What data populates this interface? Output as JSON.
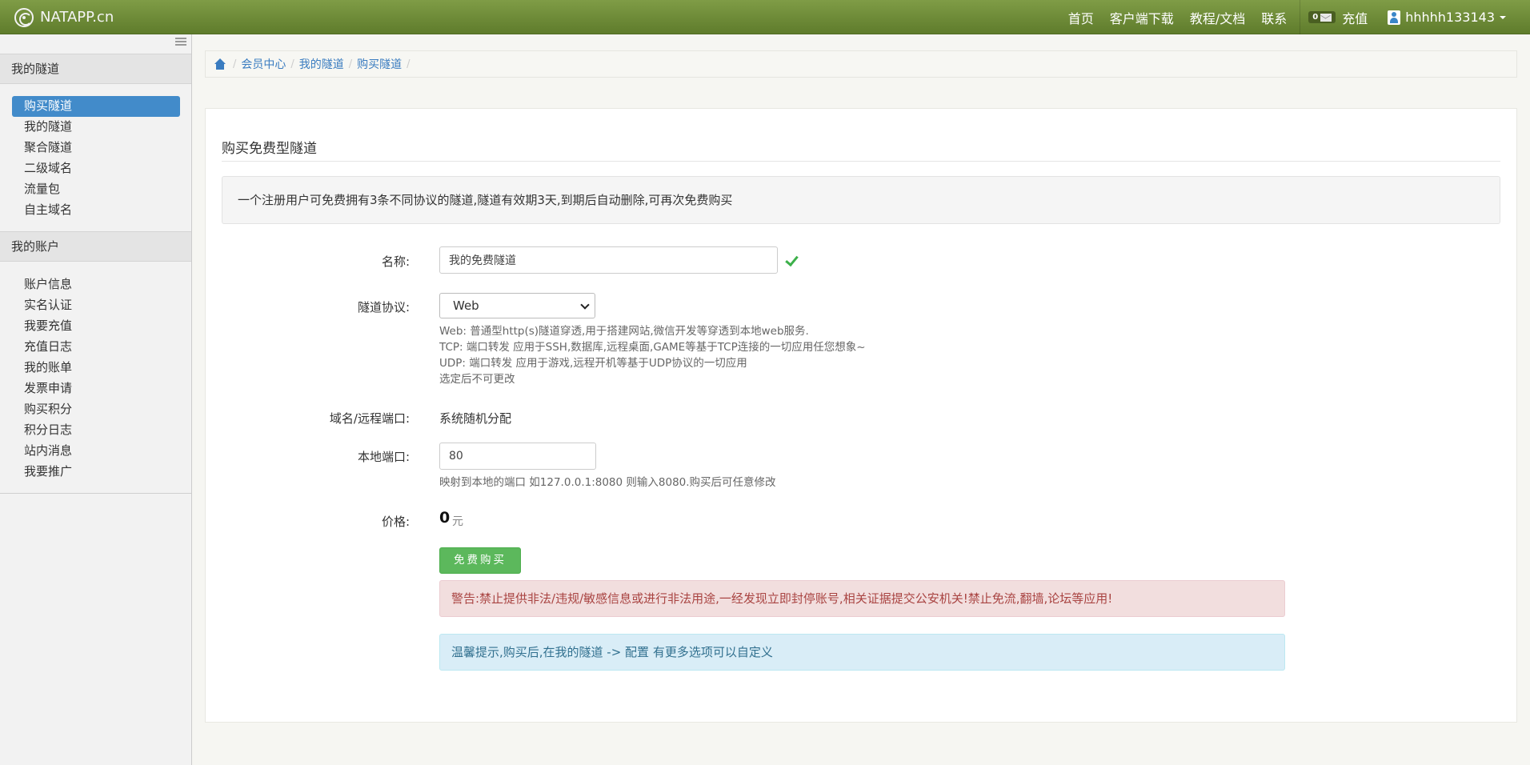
{
  "navbar": {
    "brand": "NATAPP.cn",
    "links": [
      "首页",
      "客户端下载",
      "教程/文档",
      "联系"
    ],
    "mail_count": "0",
    "recharge": "充值",
    "username": "hhhhh133143"
  },
  "sidebar": {
    "section1": "我的隧道",
    "tunnel_items": [
      "购买隧道",
      "我的隧道",
      "聚合隧道",
      "二级域名",
      "流量包",
      "自主域名"
    ],
    "section2": "我的账户",
    "account_items": [
      "账户信息",
      "实名认证",
      "我要充值",
      "充值日志",
      "我的账单",
      "发票申请",
      "购买积分",
      "积分日志",
      "站内消息",
      "我要推广"
    ]
  },
  "breadcrumb": [
    "会员中心",
    "我的隧道",
    "购买隧道"
  ],
  "main": {
    "title": "购买免费型隧道",
    "info": "一个注册用户可免费拥有3条不同协议的隧道,隧道有效期3天,到期后自动删除,可再次免费购买",
    "name_label": "名称:",
    "name_value": "我的免费隧道",
    "protocol_label": "隧道协议:",
    "protocol_value": "Web",
    "protocol_help": [
      "Web: 普通型http(s)隧道穿透,用于搭建网站,微信开发等穿透到本地web服务.",
      "TCP: 端口转发 应用于SSH,数据库,远程桌面,GAME等基于TCP连接的一切应用任您想象~",
      "UDP: 端口转发 应用于游戏,远程开机等基于UDP协议的一切应用",
      "选定后不可更改"
    ],
    "domain_label": "域名/远程端口:",
    "domain_value": "系统随机分配",
    "port_label": "本地端口:",
    "port_value": "80",
    "port_help": "映射到本地的端口 如127.0.0.1:8080 则输入8080.购买后可任意修改",
    "price_label": "价格:",
    "price_value": "0",
    "price_unit": "元",
    "buy_button": "免费购买",
    "warning": "警告:禁止提供非法/违规/敏感信息或进行非法用途,一经发现立即封停账号,相关证据提交公安机关!禁止免流,翻墙,论坛等应用!",
    "tip": "温馨提示,购买后,在我的隧道 -> 配置 有更多选项可以自定义"
  },
  "colors": {
    "navbar": "#6f8c39",
    "active": "#428bca",
    "link": "#3a7cc0",
    "success": "#5cb85c",
    "danger_text": "#a94442",
    "info_text": "#31708f"
  }
}
